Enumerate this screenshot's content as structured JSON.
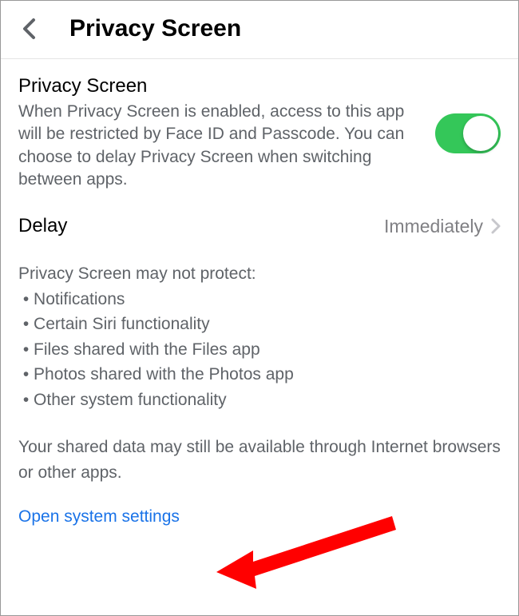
{
  "header": {
    "title": "Privacy Screen"
  },
  "privacy_toggle": {
    "title": "Privacy Screen",
    "description": "When Privacy Screen is enabled, access to this app will be restricted by Face ID and Passcode. You can choose to delay Privacy Screen when switching between apps.",
    "enabled": true
  },
  "delay": {
    "label": "Delay",
    "value": "Immediately"
  },
  "protection_info": {
    "intro": "Privacy Screen may not protect:",
    "items": [
      "Notifications",
      "Certain Siri functionality",
      "Files shared with the Files app",
      "Photos shared with the Photos app",
      "Other system functionality"
    ]
  },
  "shared_data_note": "Your shared data may still be available through Internet browsers or other apps.",
  "system_settings_link": "Open system settings"
}
